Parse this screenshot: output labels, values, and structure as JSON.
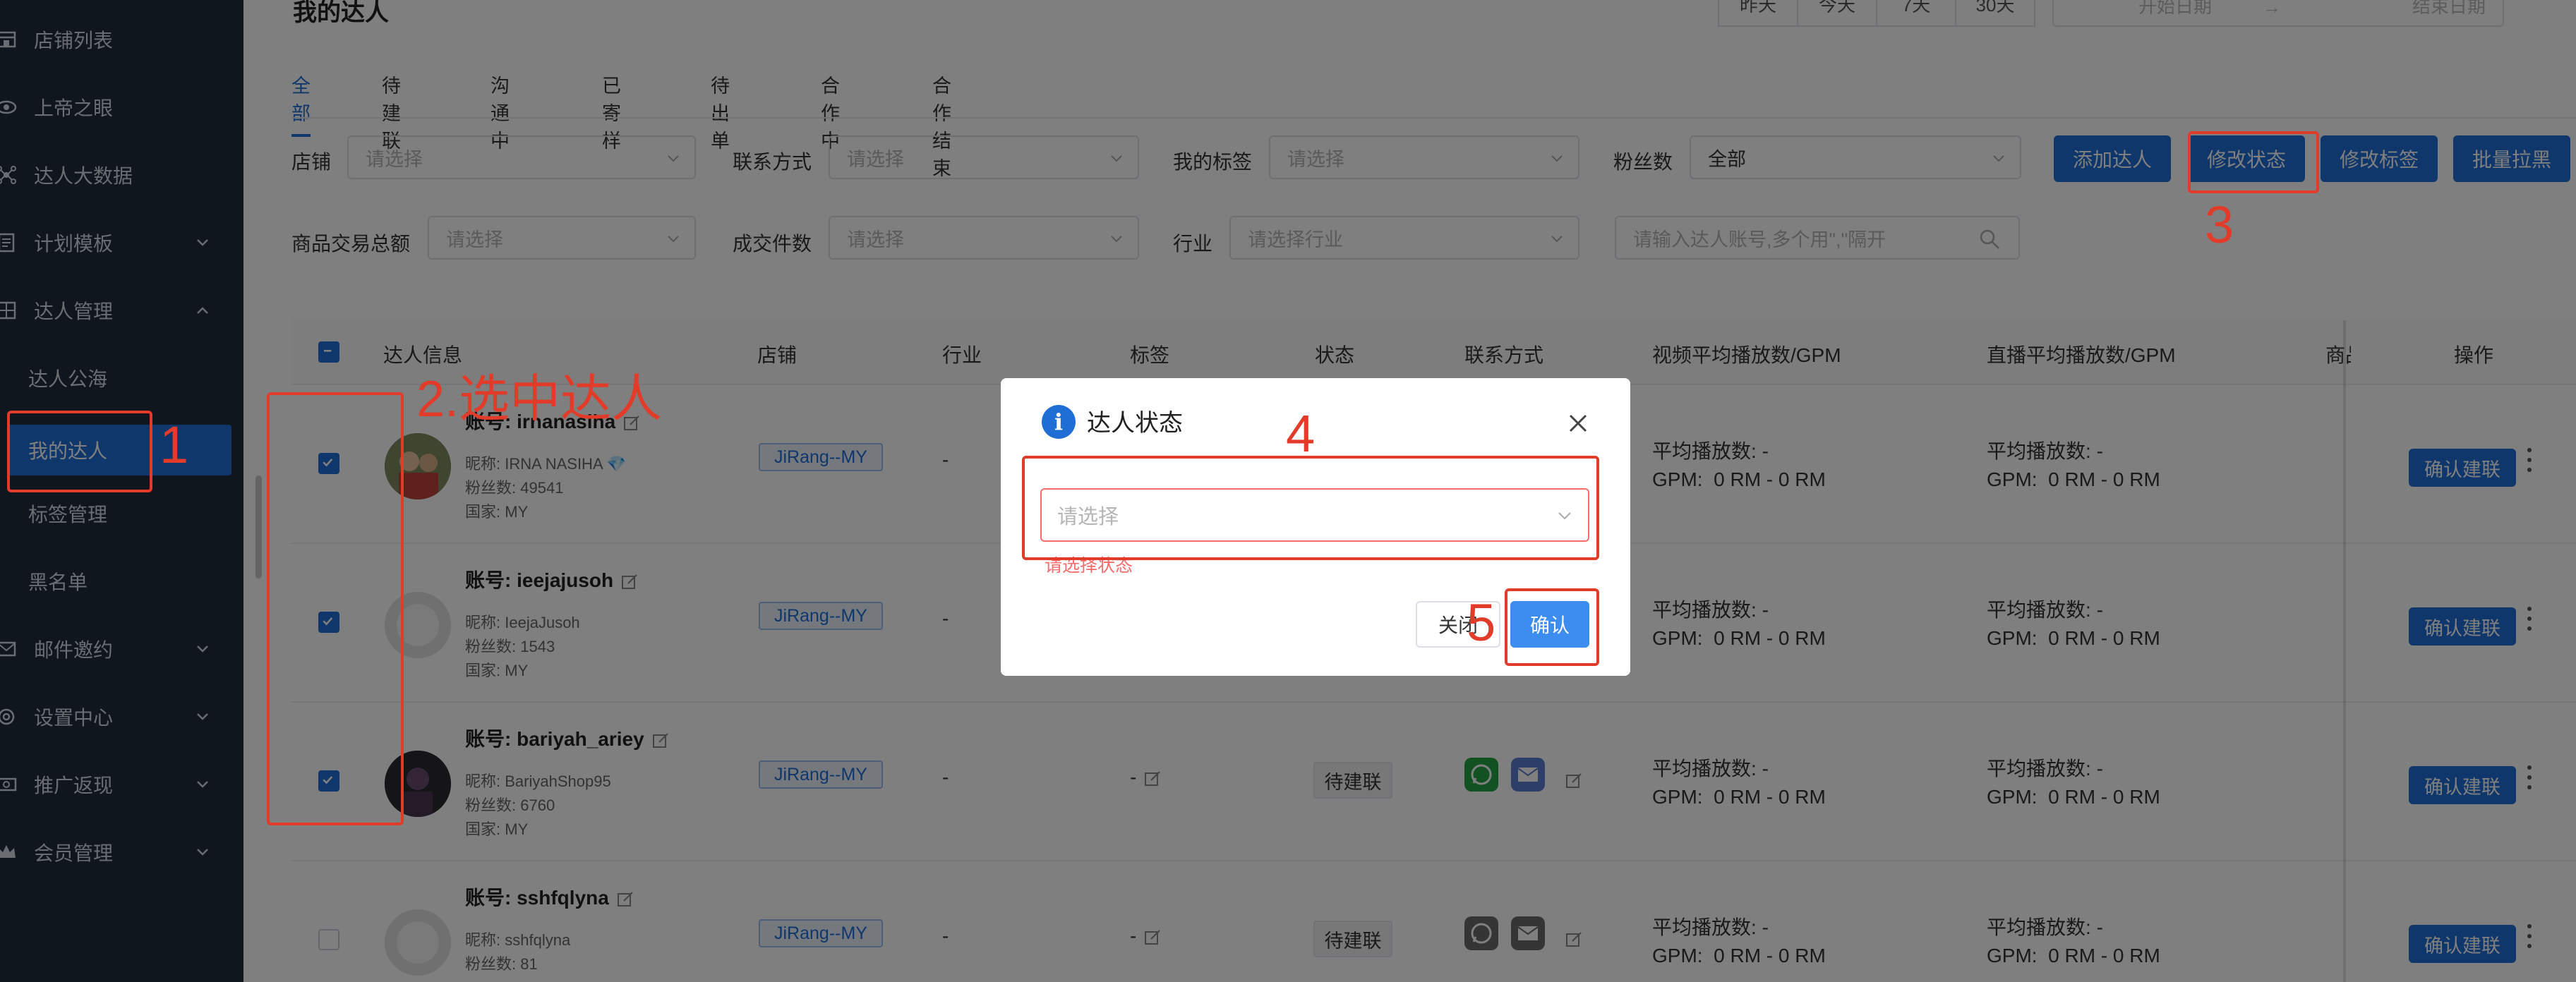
{
  "sidebar": {
    "items": [
      {
        "label": "店铺列表",
        "icon": "store-icon"
      },
      {
        "label": "上帝之眼",
        "icon": "eye-icon"
      },
      {
        "label": "达人大数据",
        "icon": "network-icon"
      },
      {
        "label": "计划模板",
        "icon": "template-icon"
      },
      {
        "label": "达人管理",
        "icon": "grid-icon"
      },
      {
        "label": "邮件邀约",
        "icon": "mail-icon"
      },
      {
        "label": "设置中心",
        "icon": "settings-icon"
      },
      {
        "label": "推广返现",
        "icon": "cash-icon"
      },
      {
        "label": "会员管理",
        "icon": "crown-icon"
      }
    ],
    "sub_items": [
      "达人公海",
      "我的达人",
      "标签管理",
      "黑名单"
    ]
  },
  "header": {
    "title": "我的达人",
    "ranges": [
      "昨天",
      "今天",
      "7天",
      "30天"
    ],
    "date_start": "开始日期",
    "date_sep": "→",
    "date_end": "结束日期"
  },
  "tabs": [
    "全部",
    "待建联",
    "沟通中",
    "已寄样",
    "待出单",
    "合作中",
    "合作结束"
  ],
  "filters": {
    "shop_label": "店铺",
    "shop_placeholder": "请选择",
    "contact_label": "联系方式",
    "contact_placeholder": "请选择",
    "tag_label": "我的标签",
    "tag_placeholder": "请选择",
    "fans_label": "粉丝数",
    "fans_value": "全部",
    "gmv_label": "商品交易总额",
    "gmv_placeholder": "请选择",
    "orders_label": "成交件数",
    "orders_placeholder": "请选择",
    "industry_label": "行业",
    "industry_placeholder": "请选择行业",
    "search_placeholder": "请输入达人账号,多个用\",\"隔开"
  },
  "actions": {
    "add": "添加达人",
    "modify_status": "修改状态",
    "modify_tag": "修改标签",
    "batch_block": "批量拉黑"
  },
  "table": {
    "columns": [
      "达人信息",
      "店铺",
      "行业",
      "标签",
      "状态",
      "联系方式",
      "视频平均播放数/GPM",
      "直播平均播放数/GPM",
      "商品",
      "操作"
    ],
    "account_prefix": "账号:",
    "nickname_prefix": "昵称:",
    "fans_prefix": "粉丝数:",
    "country_prefix": "国家:",
    "play_label": "平均播放数:",
    "gpm_label": "GPM:",
    "rows": [
      {
        "account": "irnanasiha",
        "nickname": "IRNA NASIHA 💎",
        "fans": "49541",
        "country": "MY",
        "shop": "JiRang--MY",
        "industry": "-",
        "tag": "",
        "status": "",
        "video_play": "-",
        "video_gpm": "0 RM - 0 RM",
        "live_play": "-",
        "live_gpm": "0 RM - 0 RM",
        "action": "确认建联",
        "checked": true
      },
      {
        "account": "ieejajusoh",
        "nickname": "IeejaJusoh",
        "fans": "1543",
        "country": "MY",
        "shop": "JiRang--MY",
        "industry": "-",
        "tag": "",
        "status": "",
        "video_play": "-",
        "video_gpm": "0 RM - 0 RM",
        "live_play": "-",
        "live_gpm": "0 RM - 0 RM",
        "action": "确认建联",
        "checked": true
      },
      {
        "account": "bariyah_ariey",
        "nickname": "BariyahShop95",
        "fans": "6760",
        "country": "MY",
        "shop": "JiRang--MY",
        "industry": "-",
        "tag": "-",
        "status": "待建联",
        "video_play": "-",
        "video_gpm": "0 RM - 0 RM",
        "live_play": "-",
        "live_gpm": "0 RM - 0 RM",
        "action": "确认建联",
        "checked": true
      },
      {
        "account": "sshfqlyna",
        "nickname": "sshfqlyna",
        "fans": "81",
        "country": "",
        "shop": "JiRang--MY",
        "industry": "-",
        "tag": "-",
        "status": "待建联",
        "video_play": "-",
        "video_gpm": "0 RM - 0 RM",
        "live_play": "-",
        "live_gpm": "0 RM - 0 RM",
        "action": "确认建联",
        "checked": false
      }
    ]
  },
  "dialog": {
    "title": "达人状态",
    "select_placeholder": "请选择",
    "error": "请选择状态",
    "close": "关闭",
    "confirm": "确认"
  },
  "annotations": [
    "1",
    "2.选中达人",
    "3",
    "4",
    "5"
  ],
  "colors": {
    "sidebar_bg": "#1f2c3d",
    "primary": "#1e6ed6",
    "annotation": "#e23b2a",
    "error": "#f56c6c"
  }
}
